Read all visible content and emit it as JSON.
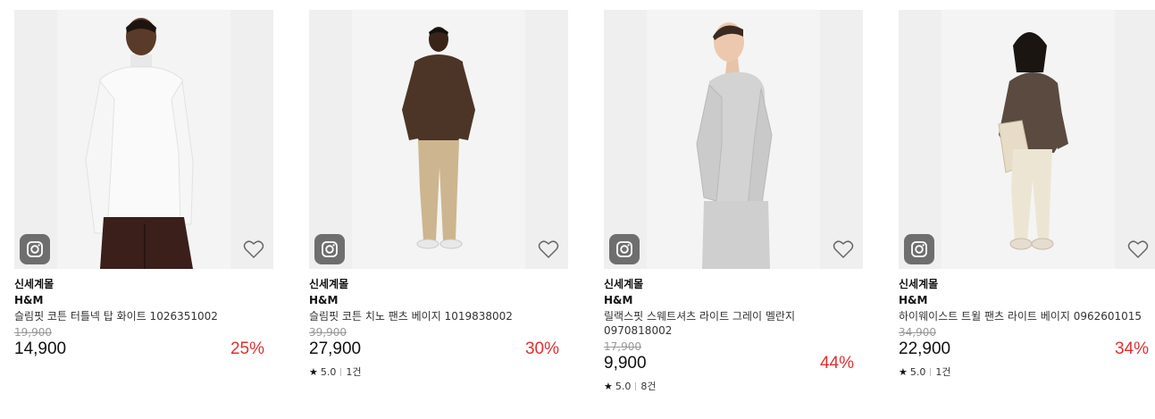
{
  "products": [
    {
      "store": "신세계몰",
      "brand": "H&M",
      "title": "슬림핏 코튼 터틀넥 탑 화이트 1026351002",
      "original_price": "19,900",
      "price": "14,900",
      "discount": "25%",
      "rating": null,
      "review_count": null
    },
    {
      "store": "신세계몰",
      "brand": "H&M",
      "title": "슬림핏 코튼 치노 팬츠 베이지 1019838002",
      "original_price": "39,900",
      "price": "27,900",
      "discount": "30%",
      "rating": "5.0",
      "review_count": "1건"
    },
    {
      "store": "신세계몰",
      "brand": "H&M",
      "title": "릴랙스핏 스웨트셔츠 라이트 그레이 멜란지 0970818002",
      "original_price": "17,900",
      "price": "9,900",
      "discount": "44%",
      "rating": "5.0",
      "review_count": "8건"
    },
    {
      "store": "신세계몰",
      "brand": "H&M",
      "title": "하이웨이스트 트윌 팬츠 라이트 베이지 0962601015",
      "original_price": "34,900",
      "price": "22,900",
      "discount": "34%",
      "rating": "5.0",
      "review_count": "1건"
    }
  ],
  "colors": {
    "discount": "#e1302f",
    "instagram_button": "#6e6e6e"
  },
  "icons": {
    "instagram": "instagram-icon",
    "wishlist": "heart-outline-icon",
    "rating": "star-icon"
  }
}
